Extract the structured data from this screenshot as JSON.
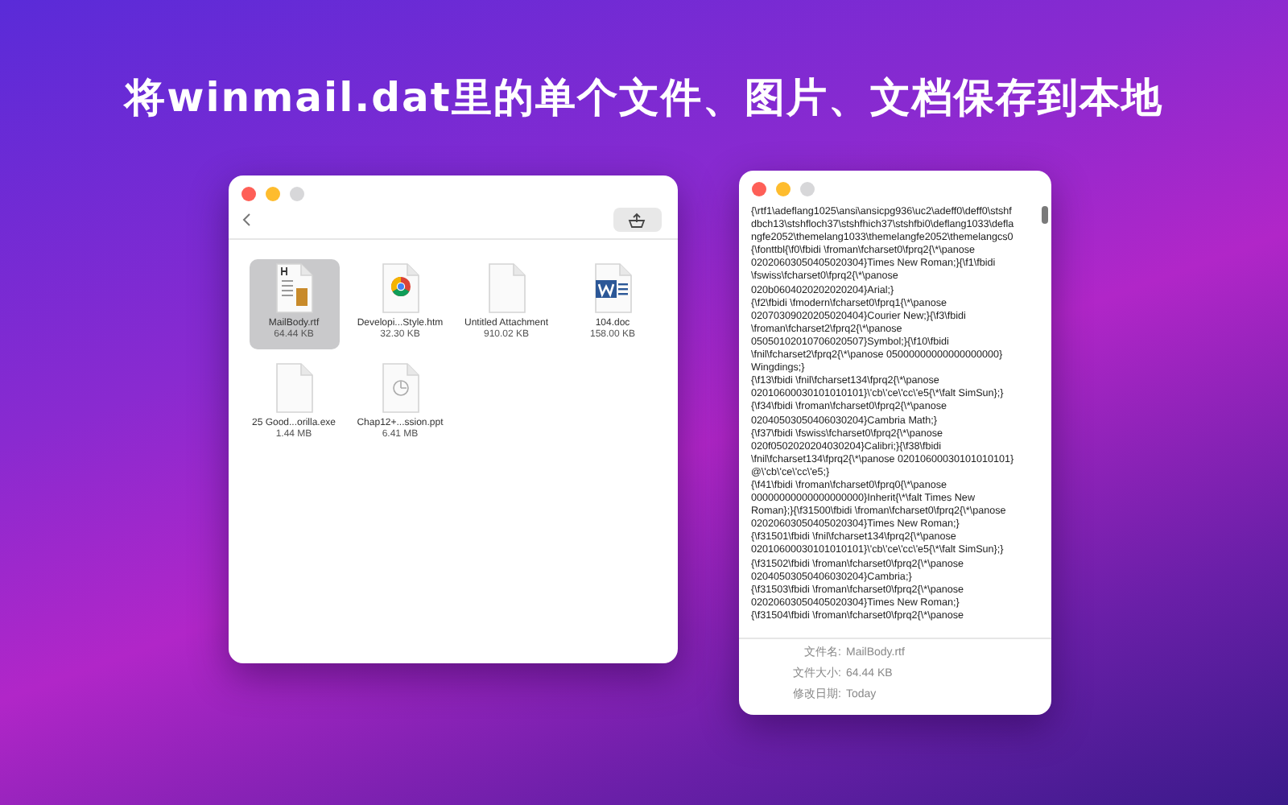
{
  "headline": "将winmail.dat里的单个文件、图片、文档保存到本地",
  "browser_window": {
    "traffic_lights": [
      {
        "kind": "close",
        "disabled": false
      },
      {
        "kind": "minimize",
        "disabled": false
      },
      {
        "kind": "zoom",
        "disabled": true
      }
    ],
    "files": [
      {
        "name": "MailBody.rtf",
        "size": "64.44 KB",
        "kind": "rtf",
        "selected": true
      },
      {
        "name": "Developi...Style.htm",
        "size": "32.30 KB",
        "kind": "html",
        "selected": false
      },
      {
        "name": "Untitled Attachment",
        "size": "910.02 KB",
        "kind": "blank",
        "selected": false
      },
      {
        "name": "104.doc",
        "size": "158.00 KB",
        "kind": "word",
        "selected": false
      },
      {
        "name": "25 Good...orilla.exe",
        "size": "1.44 MB",
        "kind": "blank",
        "selected": false
      },
      {
        "name": "Chap12+...ssion.ppt",
        "size": "6.41 MB",
        "kind": "ppt",
        "selected": false
      }
    ]
  },
  "preview_window": {
    "traffic_lights": [
      {
        "kind": "close",
        "disabled": false
      },
      {
        "kind": "minimize",
        "disabled": false
      },
      {
        "kind": "zoom",
        "disabled": true
      }
    ],
    "text_lines": [
      "{\\rtf1\\adeflang1025\\ansi\\ansicpg936\\uc2\\adeff0\\deff0\\stshf",
      "dbch13\\stshfloch37\\stshfhich37\\stshfbi0\\deflang1033\\defla",
      "ngfe2052\\themelang1033\\themelangfe2052\\themelangcs0",
      "{\\fonttbl{\\f0\\fbidi \\froman\\fcharset0\\fprq2{\\*\\panose",
      "02020603050405020304}Times New Roman;}{\\f1\\fbidi",
      "\\fswiss\\fcharset0\\fprq2{\\*\\panose",
      "020b0604020202020204}Arial;}",
      "{\\f2\\fbidi \\fmodern\\fcharset0\\fprq1{\\*\\panose",
      "02070309020205020404}Courier New;}{\\f3\\fbidi",
      "\\froman\\fcharset2\\fprq2{\\*\\panose",
      "05050102010706020507}Symbol;}{\\f10\\fbidi",
      "\\fnil\\fcharset2\\fprq2{\\*\\panose 05000000000000000000}",
      "Wingdings;}",
      "{\\f13\\fbidi \\fnil\\fcharset134\\fprq2{\\*\\panose",
      "02010600030101010101}\\'cb\\'ce\\'cc\\'e5{\\*\\falt SimSun};}",
      "{\\f34\\fbidi \\froman\\fcharset0\\fprq2{\\*\\panose",
      "02040503050406030204}Cambria Math;}",
      "{\\f37\\fbidi \\fswiss\\fcharset0\\fprq2{\\*\\panose",
      "020f0502020204030204}Calibri;}{\\f38\\fbidi",
      "\\fnil\\fcharset134\\fprq2{\\*\\panose 02010600030101010101}",
      "@\\'cb\\'ce\\'cc\\'e5;}",
      "{\\f41\\fbidi \\froman\\fcharset0\\fprq0{\\*\\panose",
      "00000000000000000000}Inherit{\\*\\falt Times New",
      "Roman};}{\\f31500\\fbidi \\froman\\fcharset0\\fprq2{\\*\\panose",
      "02020603050405020304}Times New Roman;}",
      "{\\f31501\\fbidi \\fnil\\fcharset134\\fprq2{\\*\\panose",
      "02010600030101010101}\\'cb\\'ce\\'cc\\'e5{\\*\\falt SimSun};}",
      "{\\f31502\\fbidi \\froman\\fcharset0\\fprq2{\\*\\panose",
      "02040503050406030204}Cambria;}",
      "{\\f31503\\fbidi \\froman\\fcharset0\\fprq2{\\*\\panose",
      "02020603050405020304}Times New Roman;}",
      "{\\f31504\\fbidi \\froman\\fcharset0\\fprq2{\\*\\panose"
    ],
    "info": [
      {
        "label": "文件名:",
        "value": "MailBody.rtf"
      },
      {
        "label": "文件大小:",
        "value": "64.44 KB"
      },
      {
        "label": "修改日期:",
        "value": "Today"
      }
    ]
  }
}
